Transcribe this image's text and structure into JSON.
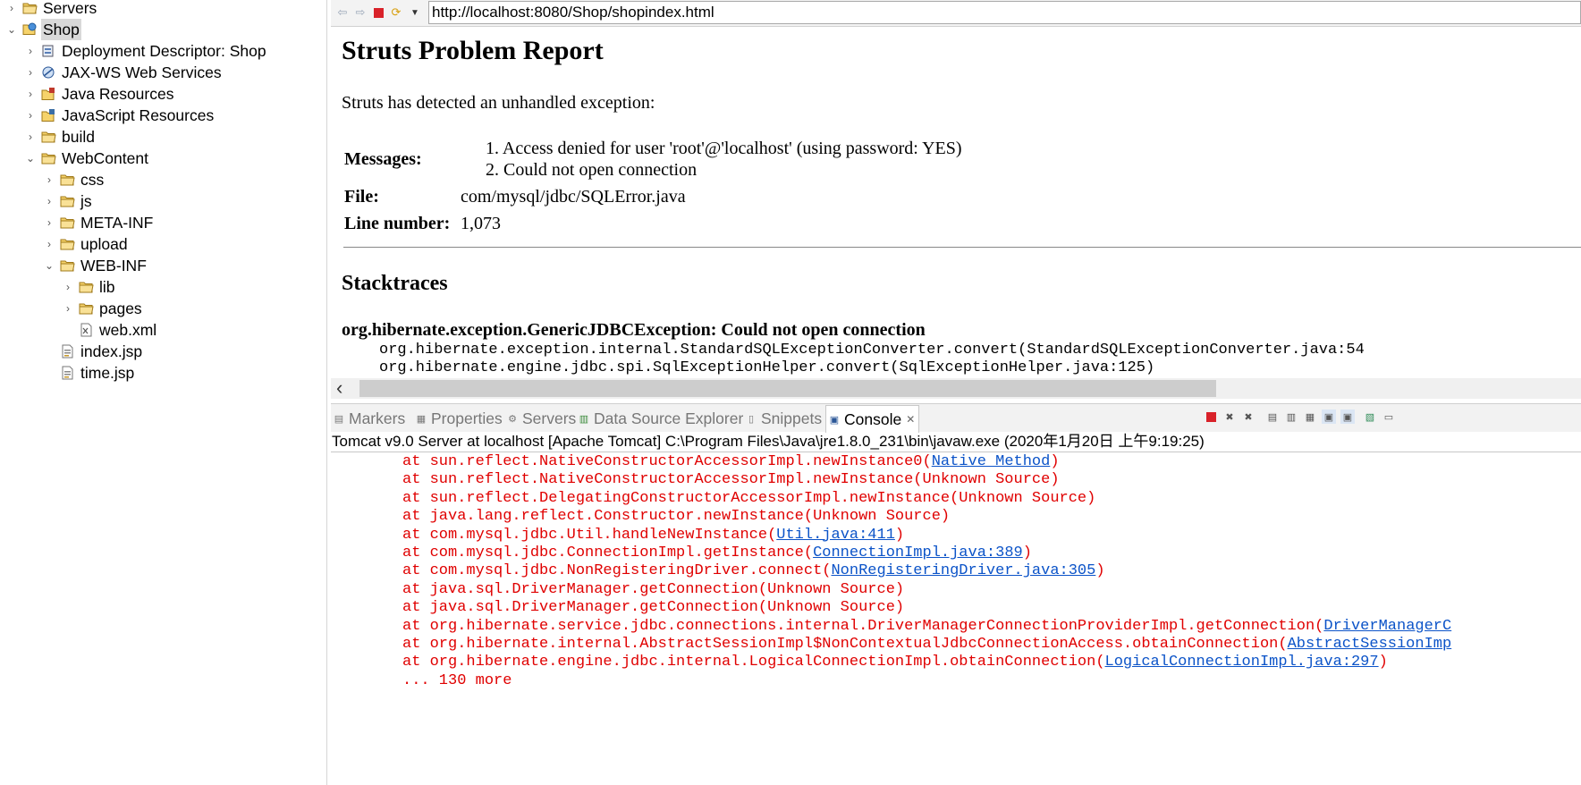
{
  "explorer": {
    "items": [
      {
        "label": "Servers",
        "arrow": "›",
        "icon": "folder-icon",
        "indent": 0
      },
      {
        "label": "Shop",
        "arrow": "⌄",
        "icon": "web-project-icon",
        "indent": 0,
        "selected": true
      },
      {
        "label": "Deployment Descriptor: Shop",
        "arrow": "›",
        "icon": "deployment-descriptor-icon",
        "indent": 1
      },
      {
        "label": "JAX-WS Web Services",
        "arrow": "›",
        "icon": "web-services-icon",
        "indent": 1
      },
      {
        "label": "Java Resources",
        "arrow": "›",
        "icon": "java-resources-icon",
        "indent": 1
      },
      {
        "label": "JavaScript Resources",
        "arrow": "›",
        "icon": "javascript-resources-icon",
        "indent": 1
      },
      {
        "label": "build",
        "arrow": "›",
        "icon": "folder-icon",
        "indent": 1
      },
      {
        "label": "WebContent",
        "arrow": "⌄",
        "icon": "folder-icon",
        "indent": 1
      },
      {
        "label": "css",
        "arrow": "›",
        "icon": "folder-icon",
        "indent": 2
      },
      {
        "label": "js",
        "arrow": "›",
        "icon": "folder-icon",
        "indent": 2
      },
      {
        "label": "META-INF",
        "arrow": "›",
        "icon": "folder-icon",
        "indent": 2
      },
      {
        "label": "upload",
        "arrow": "›",
        "icon": "folder-icon",
        "indent": 2
      },
      {
        "label": "WEB-INF",
        "arrow": "⌄",
        "icon": "folder-icon",
        "indent": 2
      },
      {
        "label": "lib",
        "arrow": "›",
        "icon": "folder-icon",
        "indent": 3
      },
      {
        "label": "pages",
        "arrow": "›",
        "icon": "folder-icon",
        "indent": 3
      },
      {
        "label": "web.xml",
        "arrow": "",
        "icon": "xml-file-icon",
        "indent": 3
      },
      {
        "label": "index.jsp",
        "arrow": "",
        "icon": "jsp-file-icon",
        "indent": 2
      },
      {
        "label": "time.jsp",
        "arrow": "",
        "icon": "jsp-file-icon",
        "indent": 2
      }
    ]
  },
  "browser": {
    "url": "http://localhost:8080/Shop/shopindex.html",
    "page": {
      "title": "Struts Problem Report",
      "intro": "Struts has detected an unhandled exception:",
      "messages_label": "Messages:",
      "messages": [
        "1.  Access denied for user 'root'@'localhost' (using password: YES)",
        "2.  Could not open connection"
      ],
      "file_label": "File:",
      "file_value": "com/mysql/jdbc/SQLError.java",
      "line_label": "Line number:",
      "line_value": "1,073",
      "stacktraces_title": "Stacktraces",
      "exception": "org.hibernate.exception.GenericJDBCException: Could not open connection",
      "trace_lines": [
        "org.hibernate.exception.internal.StandardSQLExceptionConverter.convert(StandardSQLExceptionConverter.java:54",
        "org.hibernate.engine.jdbc.spi.SqlExceptionHelper.convert(SqlExceptionHelper.java:125)"
      ]
    }
  },
  "console": {
    "tabs": [
      {
        "label": "Markers",
        "icon": "markers-icon"
      },
      {
        "label": "Properties",
        "icon": "properties-icon"
      },
      {
        "label": "Servers",
        "icon": "servers-icon"
      },
      {
        "label": "Data Source Explorer",
        "icon": "data-source-icon"
      },
      {
        "label": "Snippets",
        "icon": "snippets-icon"
      },
      {
        "label": "Console",
        "icon": "console-icon",
        "active": true
      }
    ],
    "description": "Tomcat v9.0 Server at localhost [Apache Tomcat] C:\\Program Files\\Java\\jre1.8.0_231\\bin\\javaw.exe (2020年1月20日 上午9:19:25)",
    "lines": [
      {
        "text": "at sun.reflect.NativeConstructorAccessorImpl.newInstance0(",
        "link": "Native Method",
        "tail": ")"
      },
      {
        "text": "at sun.reflect.NativeConstructorAccessorImpl.newInstance(Unknown Source)",
        "link": "",
        "tail": ""
      },
      {
        "text": "at sun.reflect.DelegatingConstructorAccessorImpl.newInstance(Unknown Source)",
        "link": "",
        "tail": ""
      },
      {
        "text": "at java.lang.reflect.Constructor.newInstance(Unknown Source)",
        "link": "",
        "tail": ""
      },
      {
        "text": "at com.mysql.jdbc.Util.handleNewInstance(",
        "link": "Util.java:411",
        "tail": ")"
      },
      {
        "text": "at com.mysql.jdbc.ConnectionImpl.getInstance(",
        "link": "ConnectionImpl.java:389",
        "tail": ")"
      },
      {
        "text": "at com.mysql.jdbc.NonRegisteringDriver.connect(",
        "link": "NonRegisteringDriver.java:305",
        "tail": ")"
      },
      {
        "text": "at java.sql.DriverManager.getConnection(Unknown Source)",
        "link": "",
        "tail": ""
      },
      {
        "text": "at java.sql.DriverManager.getConnection(Unknown Source)",
        "link": "",
        "tail": ""
      },
      {
        "text": "at org.hibernate.service.jdbc.connections.internal.DriverManagerConnectionProviderImpl.getConnection(",
        "link": "DriverManagerC",
        "tail": ""
      },
      {
        "text": "at org.hibernate.internal.AbstractSessionImpl$NonContextualJdbcConnectionAccess.obtainConnection(",
        "link": "AbstractSessionImp",
        "tail": ""
      },
      {
        "text": "at org.hibernate.engine.jdbc.internal.LogicalConnectionImpl.obtainConnection(",
        "link": "LogicalConnectionImpl.java:297",
        "tail": ")"
      },
      {
        "text": "... 130 more",
        "link": "",
        "tail": ""
      }
    ]
  }
}
